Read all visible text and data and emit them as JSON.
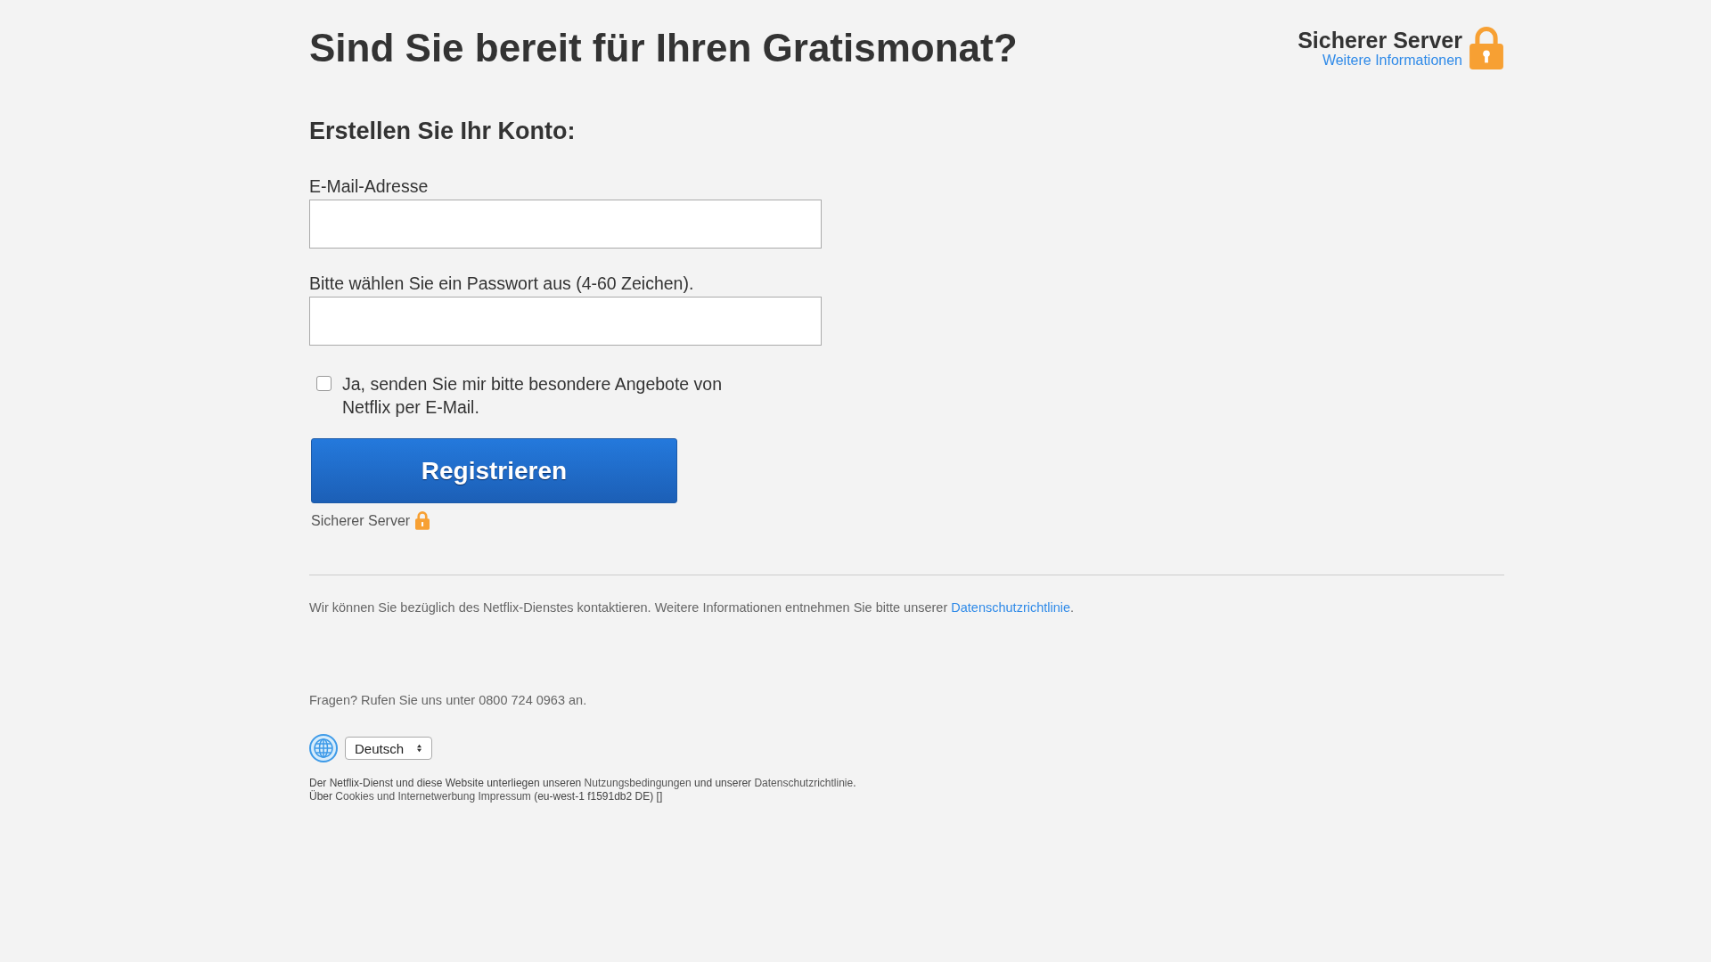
{
  "page_title": "Sind Sie bereit für Ihren Gratismonat?",
  "secure_badge": {
    "title": "Sicherer Server",
    "link": "Weitere Informationen"
  },
  "form": {
    "heading": "Erstellen Sie Ihr Konto:",
    "fields": [
      {
        "label": "E-Mail-Adresse"
      },
      {
        "label": "Bitte wählen Sie ein Passwort aus (4-60 Zeichen)."
      }
    ],
    "offers_checkbox": {
      "label": "Ja, senden Sie mir bitte besondere Angebote von Netflix per E-Mail.",
      "checked": false
    },
    "submit_button": "Registrieren",
    "secure_note": "Sicherer Server"
  },
  "privacy_notice": [
    {
      "kind": "text",
      "text": "Wir können Sie bezüglich des Netflix-Dienstes kontaktieren. Weitere Informationen entnehmen Sie bitte unserer "
    },
    {
      "kind": "link",
      "text": "Datenschutzrichtlinie"
    },
    {
      "kind": "text",
      "text": "."
    }
  ],
  "contact": "Fragen? Rufen Sie uns unter 0800 724 0963 an.",
  "language_select": {
    "value": "Deutsch"
  },
  "footer_lines": [
    [
      {
        "kind": "text",
        "text": "Der Netflix-Dienst und diese Website unterliegen unseren "
      },
      {
        "kind": "link",
        "text": "Nutzungsbedingungen"
      },
      {
        "kind": "text",
        "text": " und unserer "
      },
      {
        "kind": "link",
        "text": "Datenschutzrichtlinie"
      },
      {
        "kind": "text",
        "text": "."
      }
    ],
    [
      {
        "kind": "text",
        "text": "Über "
      },
      {
        "kind": "link",
        "text": "Cookies und Internetwerbung"
      },
      {
        "kind": "link",
        "text": "Impressum"
      },
      {
        "kind": "text",
        "text": " (eu-west-1 f1591db2 DE) []"
      }
    ]
  ]
}
